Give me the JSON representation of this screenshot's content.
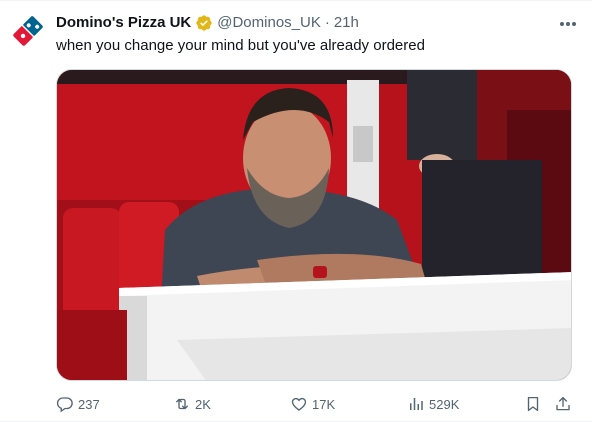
{
  "tweet": {
    "author": {
      "display_name": "Domino's Pizza UK",
      "handle": "@Dominos_UK",
      "verified_color": "#e2b719",
      "avatar_icon": "dominos-logo-icon",
      "brand_colors": {
        "blue": "#006491",
        "red": "#e31837"
      }
    },
    "separator": "·",
    "timestamp": "21h",
    "text": "when you change your mind but you've already ordered",
    "media": {
      "kind": "photo",
      "scene": "man-with-crossed-arms-in-red-stadium-seats"
    },
    "actions": {
      "replies": "237",
      "reposts": "2K",
      "likes": "17K",
      "views": "529K"
    }
  },
  "colors": {
    "text_primary": "#0f1419",
    "text_secondary": "#536471",
    "border": "#cfd9de"
  }
}
